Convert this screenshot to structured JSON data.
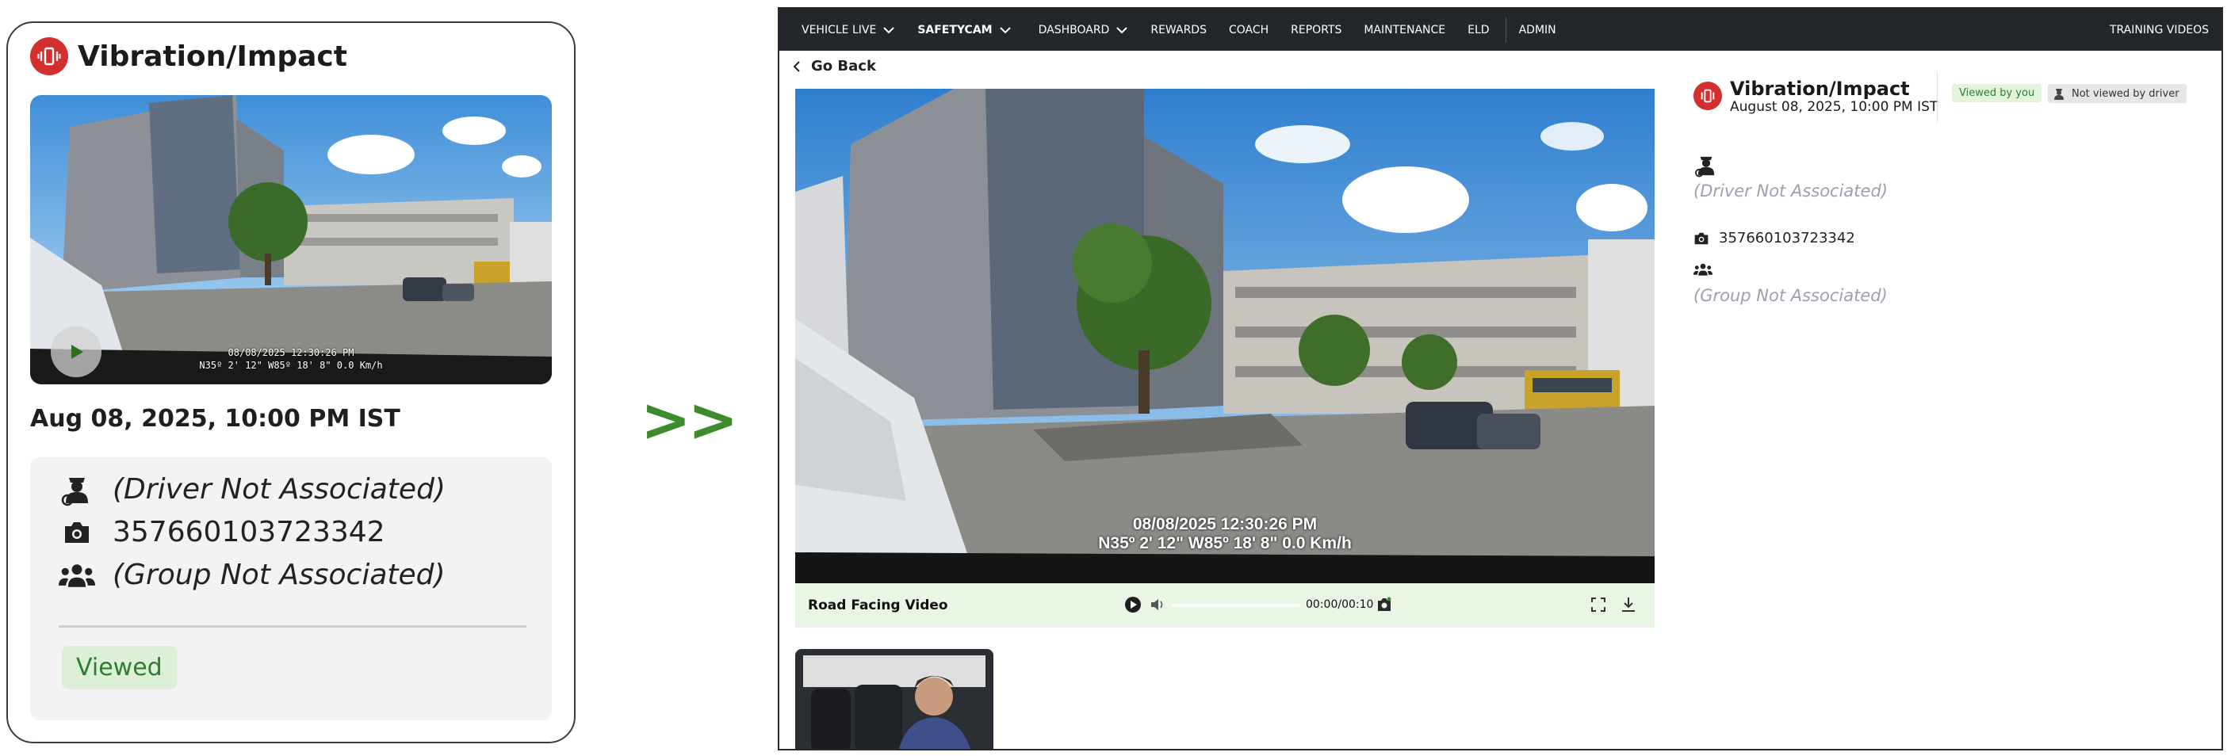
{
  "card": {
    "title": "Vibration/Impact",
    "date": "Aug 08, 2025, 10:00 PM IST",
    "thumb_stamp_line1": "08/08/2025 12:30:26 PM",
    "thumb_stamp_line2": "N35º 2' 12\" W85º 18' 8\" 0.0 Km/h",
    "driver": "(Driver Not Associated)",
    "camera_id": "357660103723342",
    "group": "(Group Not Associated)",
    "viewed": "Viewed",
    "icons": [
      "vibration-icon",
      "play-icon",
      "driver-icon",
      "camera-icon",
      "group-icon"
    ]
  },
  "arrow": ">>",
  "nav": {
    "items": [
      "VEHICLE LIVE",
      "SAFETYCAM",
      "DASHBOARD",
      "REWARDS",
      "COACH",
      "REPORTS",
      "MAINTENANCE",
      "ELD",
      "ADMIN"
    ],
    "right": "TRAINING VIDEOS",
    "active": "SAFETYCAM"
  },
  "goback": "Go Back",
  "video": {
    "stamp_line1": "08/08/2025 12:30:26 PM",
    "stamp_line2": "N35º 2' 12\" W85º 18' 8\" 0.0 Km/h",
    "label": "Road Facing Video",
    "time": "00:00/00:10"
  },
  "side": {
    "title": "Vibration/Impact",
    "date": "August 08, 2025, 10:00 PM IST",
    "viewed_by_you": "Viewed by you",
    "not_viewed_by_driver": "Not viewed by driver",
    "driver": "(Driver Not Associated)",
    "camera_id": "357660103723342",
    "group": "(Group Not Associated)"
  },
  "colors": {
    "accent_red": "#d32f2f",
    "nav_bg": "#23262b",
    "viewed_green": "#2e7d32",
    "arrow_green": "#3c8c2c"
  }
}
